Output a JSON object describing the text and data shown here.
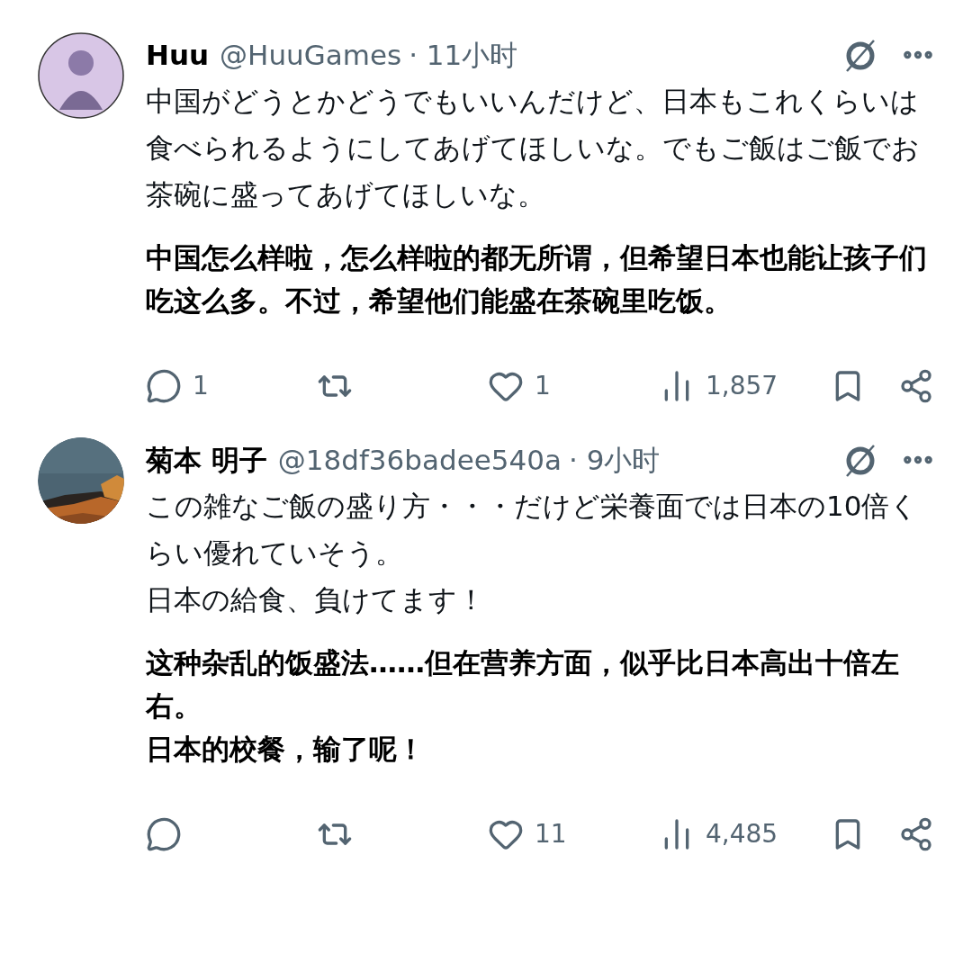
{
  "posts": [
    {
      "avatar": {
        "kind": "figure"
      },
      "name": "Huu",
      "handle": "@HuuGames",
      "time": "· 11小时",
      "text_lines": [
        "中国がどうとかどうでもいいんだけど、日本もこれくらいは食べられるようにしてあげてほしいな。でもご飯はご飯でお茶碗に盛ってあげてほしいな。"
      ],
      "translation_lines": [
        "中国怎么样啦，怎么样啦的都无所谓，但希望日本也能让孩子们吃这么多。不过，希望他们能盛在茶碗里吃饭。"
      ],
      "replies": "1",
      "likes": "1",
      "views": "1,857"
    },
    {
      "name": "菊本 明子",
      "handle": "@18df36badee540a",
      "time": "· 9小时",
      "text_lines": [
        "この雑なご飯の盛り方・・・だけど栄養面では日本の10倍くらい優れていそう。",
        "日本の給食、負けてます！"
      ],
      "translation_lines": [
        "这种杂乱的饭盛法……但在营养方面，似乎比日本高出十倍左右。",
        "日本的校餐，输了呢！"
      ],
      "likes": "11",
      "views": "4,485"
    }
  ]
}
